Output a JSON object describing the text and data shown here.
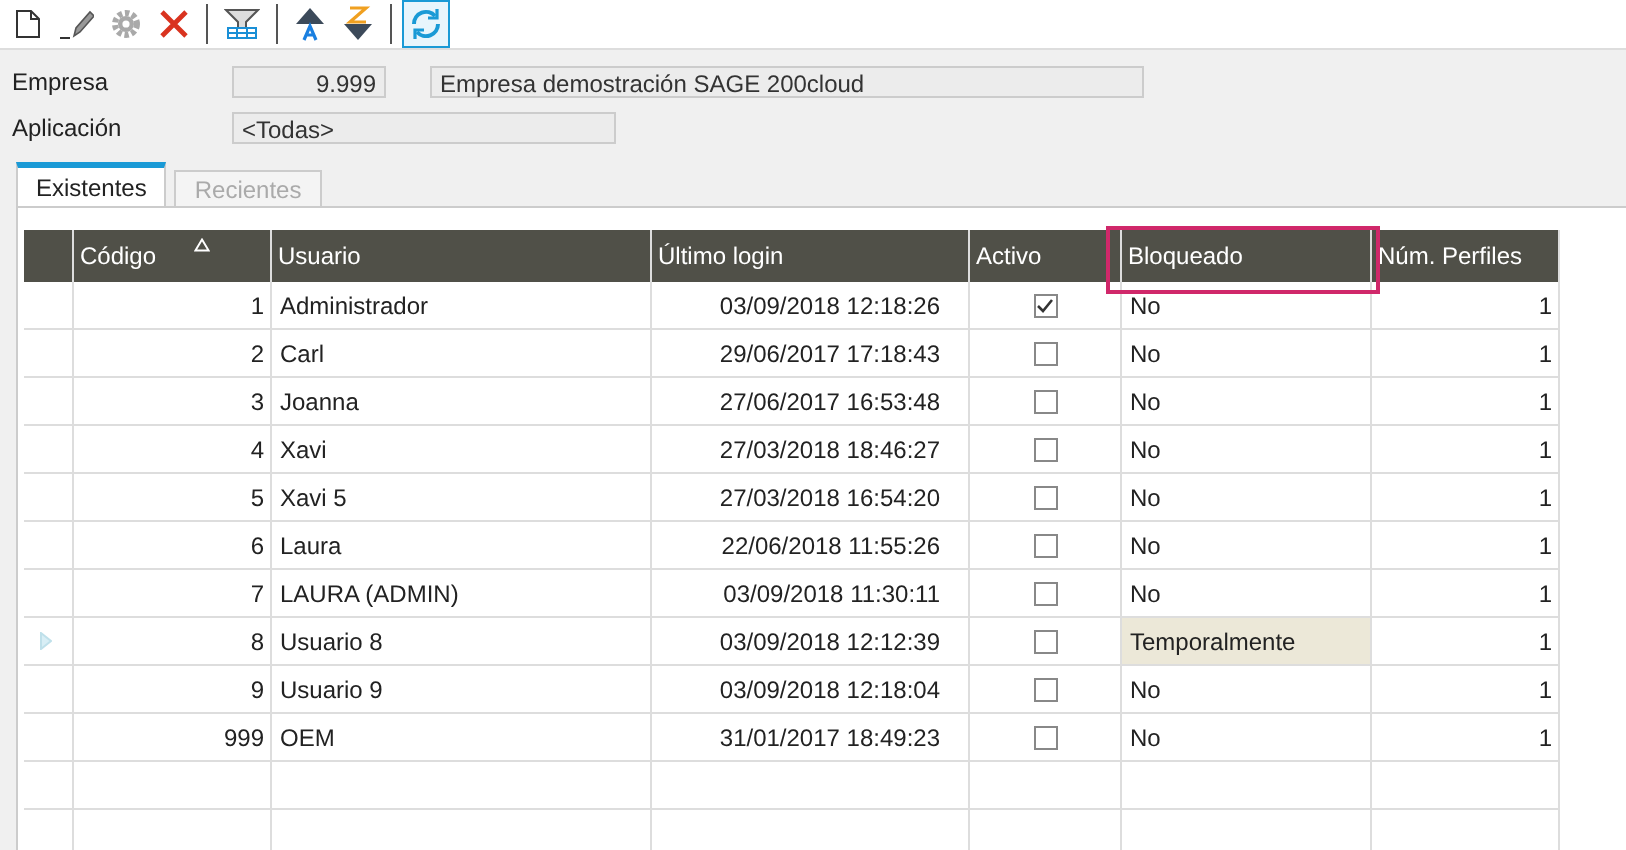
{
  "toolbar": [
    {
      "tools": [
        {
          "kind": "new",
          "disabled": false,
          "selected": false
        },
        {
          "kind": "edit",
          "disabled": false,
          "selected": false
        },
        {
          "kind": "settings",
          "disabled": true,
          "selected": false
        },
        {
          "kind": "delete",
          "disabled": false,
          "selected": false
        }
      ]
    },
    {
      "tools": [
        {
          "kind": "filter",
          "disabled": false,
          "selected": false
        }
      ]
    },
    {
      "tools": [
        {
          "kind": "sort-asc",
          "disabled": false,
          "selected": false
        },
        {
          "kind": "sort-desc",
          "disabled": false,
          "selected": false
        }
      ]
    },
    {
      "tools": [
        {
          "kind": "refresh",
          "disabled": false,
          "selected": true
        }
      ]
    }
  ],
  "form": {
    "empresa": {
      "label": "Empresa",
      "code": "9.999",
      "name": "Empresa demostración SAGE 200cloud"
    },
    "aplicacion": {
      "label": "Aplicación",
      "value": "<Todas>"
    }
  },
  "tabs": [
    {
      "label": "Existentes",
      "selected": true,
      "disabled": false
    },
    {
      "label": "Recientes",
      "selected": false,
      "disabled": true
    }
  ],
  "table": {
    "columns": [
      {
        "label": "Código",
        "sorted": true
      },
      {
        "label": "Usuario",
        "sorted": false
      },
      {
        "label": "Último login",
        "sorted": false
      },
      {
        "label": "Activo",
        "sorted": false
      },
      {
        "label": "Bloqueado",
        "sorted": false,
        "highlighted": true
      },
      {
        "label": "Núm. Perfiles",
        "sorted": false
      }
    ],
    "rows": [
      {
        "codigo": "1",
        "usuario": "Administrador",
        "login": "03/09/2018 12:18:26",
        "activo": true,
        "bloqueado": "No",
        "perfiles": "1",
        "selected": false
      },
      {
        "codigo": "2",
        "usuario": "Carl",
        "login": "29/06/2017 17:18:43",
        "activo": false,
        "bloqueado": "No",
        "perfiles": "1",
        "selected": false
      },
      {
        "codigo": "3",
        "usuario": "Joanna",
        "login": "27/06/2017 16:53:48",
        "activo": false,
        "bloqueado": "No",
        "perfiles": "1",
        "selected": false
      },
      {
        "codigo": "4",
        "usuario": "Xavi",
        "login": "27/03/2018 18:46:27",
        "activo": false,
        "bloqueado": "No",
        "perfiles": "1",
        "selected": false
      },
      {
        "codigo": "5",
        "usuario": "Xavi 5",
        "login": "27/03/2018 16:54:20",
        "activo": false,
        "bloqueado": "No",
        "perfiles": "1",
        "selected": false
      },
      {
        "codigo": "6",
        "usuario": "Laura",
        "login": "22/06/2018 11:55:26",
        "activo": false,
        "bloqueado": "No",
        "perfiles": "1",
        "selected": false
      },
      {
        "codigo": "7",
        "usuario": "LAURA (ADMIN)",
        "login": "03/09/2018 11:30:11",
        "activo": false,
        "bloqueado": "No",
        "perfiles": "1",
        "selected": false
      },
      {
        "codigo": "8",
        "usuario": "Usuario 8",
        "login": "03/09/2018 12:12:39",
        "activo": false,
        "bloqueado": "Temporalmente",
        "perfiles": "1",
        "selected": true
      },
      {
        "codigo": "9",
        "usuario": "Usuario 9",
        "login": "03/09/2018 12:18:04",
        "activo": false,
        "bloqueado": "No",
        "perfiles": "1",
        "selected": false
      },
      {
        "codigo": "999",
        "usuario": "OEM",
        "login": "31/01/2017 18:49:23",
        "activo": false,
        "bloqueado": "No",
        "perfiles": "1",
        "selected": false
      }
    ]
  }
}
